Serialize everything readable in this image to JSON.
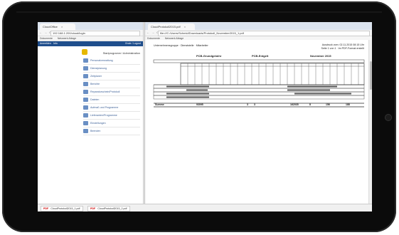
{
  "left_window": {
    "tab_label": "CloudOffice",
    "tab_close": "×",
    "nav_glyphs": "← → C",
    "url": "192.168.1.200/cloud/login",
    "bookmarks": [
      "Dokumente",
      "Netzwerk Ablage"
    ],
    "appbar": {
      "left": "Anmelden",
      "mid": "Info",
      "right": "Ende / Logout"
    },
    "app_title": "Startprogramm / Administration",
    "menu": [
      "Personalverwaltung",
      "Dienstplanung",
      "Zeitplaner",
      "Berichte",
      "Reparaturschein/Protokoll",
      "Dateien",
      "Aufmaß und Programme",
      "Lieferanten/Programme",
      "Einstellungen",
      "Beenden"
    ]
  },
  "right_window": {
    "tab_label": "CloudProtokoll2015.pdf",
    "tab_close": "×",
    "nav_glyphs": "← → C",
    "url": "file:///C:/Users/Schmid/Downloads/Protokoll_November2015_1.pdf",
    "bookmarks": [
      "Dokumente",
      "Netzwerk Ablage"
    ],
    "doc": {
      "header_left": "Unternehmensgruppe · Dienststelle · Mitarbeiter",
      "header_right_1": "Ausdruck vom: 02.11.2015 08:15 Uhr",
      "header_right_2": "Seite 1 von 1 · Im PDF-Format erstellt",
      "col_title_1": "PCB-Grundgebühr",
      "col_title_2": "PCB-Entgelt",
      "col_title_3": "November 2015",
      "sum_label": "Summe",
      "sum_values": [
        "93095",
        "3",
        "3",
        "162035",
        "8",
        "156",
        "188"
      ]
    }
  },
  "downloads": [
    {
      "icon": "PDF",
      "label": "CloudProtokoll2015_1.pdf"
    },
    {
      "icon": "PDF",
      "label": "CloudProtokoll2015_2.pdf"
    }
  ]
}
